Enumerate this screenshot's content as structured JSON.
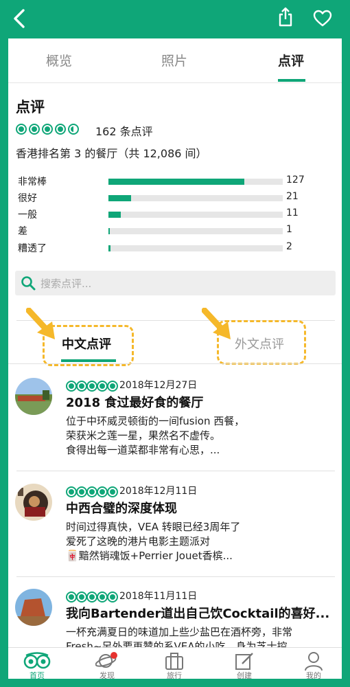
{
  "header": {
    "back_icon": "chevron-left-icon",
    "share_icon": "share-icon",
    "fav_icon": "heart-icon"
  },
  "tabs": [
    {
      "label": "概览"
    },
    {
      "label": "照片"
    },
    {
      "label": "点评",
      "active": true
    }
  ],
  "reviews_section": {
    "title": "点评",
    "rating": 4.5,
    "count_text": "162 条点评",
    "rank_text": "香港排名第 3 的餐厅（共 12,086 间）"
  },
  "distribution": [
    {
      "label": "非常棒",
      "count": "127",
      "fraction": 0.78
    },
    {
      "label": "很好",
      "count": "21",
      "fraction": 0.13
    },
    {
      "label": "一般",
      "count": "11",
      "fraction": 0.07
    },
    {
      "label": "差",
      "count": "1",
      "fraction": 0.008
    },
    {
      "label": "糟透了",
      "count": "2",
      "fraction": 0.012
    }
  ],
  "search": {
    "placeholder": "搜索点评..."
  },
  "language_tabs": [
    {
      "label": "中文点评",
      "active": true
    },
    {
      "label": "外文点评"
    }
  ],
  "reviews": [
    {
      "rating": 5,
      "date": "2018年12月27日",
      "title": "2018 食过最好食的餐厅",
      "lines": [
        "位于中环威灵顿街的一间fusion 西餐，",
        "荣获米之莲一星，果然名不虚传。",
        "食得出每一道菜都非常有心思，..."
      ]
    },
    {
      "rating": 5,
      "date": "2018年12月11日",
      "title": "中西合璧的深度体现",
      "lines": [
        "时间过得真快，VEA 转眼已经3周年了",
        "爱死了这晚的港片电影主题派对",
        "🀄黯然销魂饭+Perrier Jouet香槟..."
      ]
    },
    {
      "rating": 5,
      "date": "2018年11月11日",
      "title": "我向Bartender道出自己饮Cocktail的喜好...",
      "lines": [
        "一杯充满夏日的味道加上些少盐巴在酒杯旁，非常",
        "Fresh~另外要再赞的系VEA的小吃。身为芝士控"
      ]
    }
  ],
  "bottom_nav": [
    {
      "label": "首页",
      "icon": "owl-icon"
    },
    {
      "label": "发现",
      "icon": "planet-icon"
    },
    {
      "label": "旅行",
      "icon": "suitcase-icon"
    },
    {
      "label": "创建",
      "icon": "edit-icon"
    },
    {
      "label": "我的",
      "icon": "profile-icon"
    }
  ]
}
